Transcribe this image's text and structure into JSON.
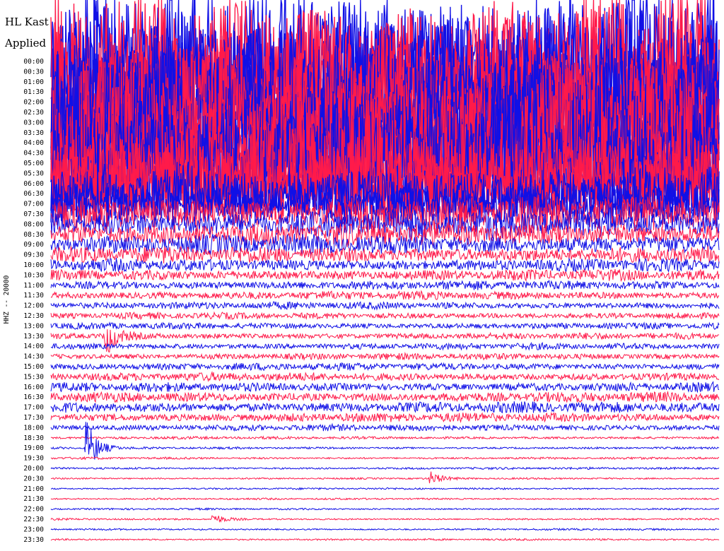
{
  "header": {
    "station": "HL Kast",
    "filter": "Applied"
  },
  "chart_data": {
    "type": "line",
    "ylabel": "HHZ -- 20000",
    "series_colors": [
      "#ff1a4a",
      "#1010e6"
    ],
    "row_colors_pattern": "alternating",
    "time_labels": [
      "00:00",
      "00:30",
      "01:00",
      "01:30",
      "02:00",
      "02:30",
      "03:00",
      "03:30",
      "04:00",
      "04:30",
      "05:00",
      "05:30",
      "06:00",
      "06:30",
      "07:00",
      "07:30",
      "08:00",
      "08:30",
      "09:00",
      "09:30",
      "10:00",
      "10:30",
      "11:00",
      "11:30",
      "12:00",
      "12:30",
      "13:00",
      "13:30",
      "14:00",
      "14:30",
      "15:00",
      "15:30",
      "16:00",
      "16:30",
      "17:00",
      "17:30",
      "18:00",
      "18:30",
      "19:00",
      "19:30",
      "20:00",
      "20:30",
      "21:00",
      "21:30",
      "22:00",
      "22:30",
      "23:00",
      "23:30"
    ],
    "row_colors": [
      "blue",
      "red",
      "blue",
      "red",
      "blue",
      "red",
      "blue",
      "red",
      "blue",
      "red",
      "blue",
      "red",
      "red",
      "blue",
      "blue",
      "red",
      "blue",
      "red",
      "blue",
      "red",
      "blue",
      "red",
      "blue",
      "red",
      "blue",
      "red",
      "blue",
      "red",
      "blue",
      "red",
      "blue",
      "red",
      "blue",
      "red",
      "blue",
      "red",
      "blue",
      "red",
      "blue",
      "red",
      "blue",
      "red",
      "blue",
      "red",
      "blue",
      "red",
      "blue",
      "red"
    ],
    "row_amplitude": [
      9,
      9,
      9,
      9,
      9,
      9,
      9,
      9,
      9,
      9,
      8,
      6,
      4,
      3.2,
      2.2,
      2.0,
      1.6,
      1.3,
      1.1,
      0.9,
      0.7,
      0.6,
      0.5,
      0.45,
      0.4,
      0.35,
      0.35,
      0.35,
      0.35,
      0.35,
      0.4,
      0.45,
      0.5,
      0.55,
      0.6,
      0.5,
      0.35,
      0.15,
      0.12,
      0.12,
      0.12,
      0.1,
      0.1,
      0.1,
      0.1,
      0.1,
      0.1,
      0.1
    ],
    "spikes": [
      {
        "row": 27,
        "t": 0.085,
        "amp": 1.6
      },
      {
        "row": 38,
        "t": 0.055,
        "amp": 2.6
      },
      {
        "row": 41,
        "t": 0.57,
        "amp": 0.6
      },
      {
        "row": 45,
        "t": 0.245,
        "amp": 0.5
      }
    ]
  }
}
